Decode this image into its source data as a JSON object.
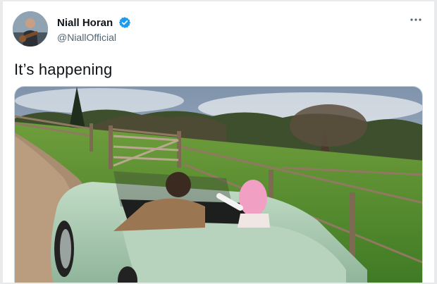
{
  "user": {
    "display_name": "Niall Horan",
    "handle": "@NiallOfficial",
    "verified": true
  },
  "tweet": {
    "text": "It’s happening"
  },
  "icons": {
    "verified": "verified-badge-icon",
    "more": "more-options-icon"
  },
  "colors": {
    "verified_blue": "#1d9bf0",
    "handle_gray": "#536471",
    "car_mint": "#a9c7b0"
  }
}
